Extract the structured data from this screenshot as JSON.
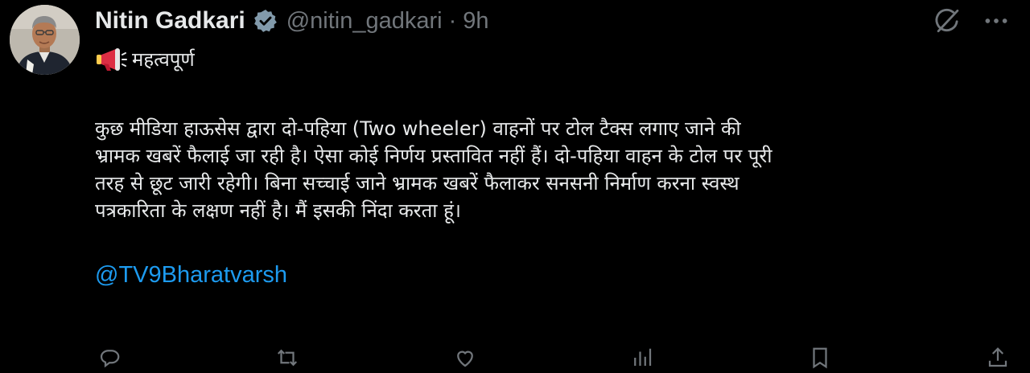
{
  "author": {
    "display_name": "Nitin Gadkari",
    "handle": "@nitin_gadkari",
    "separator": "·",
    "time": "9h",
    "verified_icon": "verified-badge-icon",
    "avatar": "profile-photo"
  },
  "header_icons": [
    "grok-icon",
    "more-options-icon"
  ],
  "tweet": {
    "emoji_icon": "megaphone-icon",
    "headline": "महत्वपूर्ण",
    "body": "कुछ मीडिया हाऊसेस  द्वारा दो-पहिया (Two wheeler) वाहनों पर टोल टैक्स लगाए जाने की\nभ्रामक खबरें फैलाई जा रही है। ऐसा कोई निर्णय प्रस्तावित नहीं हैं। दो-पहिया वाहन के टोल पर पूरी\nतरह से छूट जारी रहेगी। बिना सच्चाई जाने भ्रामक खबरें फैलाकर सनसनी निर्माण करना स्वस्थ\nपत्रकारिता के लक्षण नहीं है। मैं इसकी निंदा करता हूं।",
    "mention": "@TV9Bharatvarsh"
  },
  "action_icons": [
    "reply-icon",
    "repost-icon",
    "like-icon",
    "views-icon",
    "bookmark-icon",
    "share-icon"
  ],
  "colors": {
    "background": "#000000",
    "text": "#e7e9ea",
    "secondary": "#71767b",
    "link": "#1d9bf0",
    "verified_badge": "#829aab",
    "megaphone": "#dd2e44"
  }
}
